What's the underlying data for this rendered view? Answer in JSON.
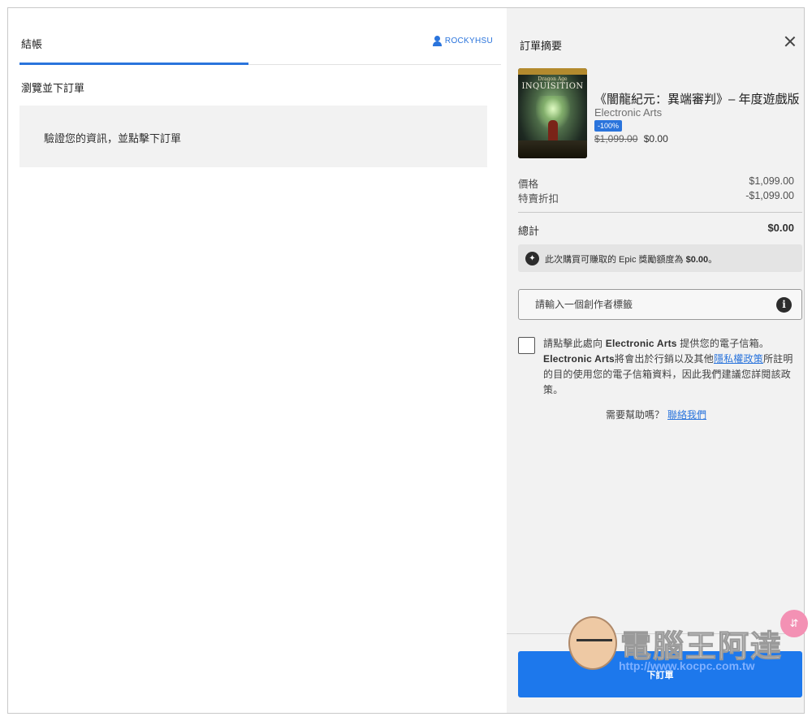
{
  "checkout": {
    "tab_label": "結帳",
    "username": "ROCKYHSU",
    "review_title": "瀏覽並下訂單",
    "verify_message": "驗證您的資訊，並點擊下訂單"
  },
  "summary": {
    "title": "訂單摘要",
    "game": {
      "cover_subtitle": "Dragon Age",
      "cover_title": "INQUISITION",
      "title": "《闇龍紀元：異端審判》– 年度遊戲版",
      "publisher": "Electronic Arts",
      "discount": "-100%",
      "original_price": "$1,099.00",
      "final_price": "$0.00"
    },
    "price_label": "價格",
    "price_value": "$1,099.00",
    "discount_label": "特賣折扣",
    "discount_value": "-$1,099.00",
    "total_label": "總計",
    "total_value": "$0.00",
    "reward_text": "此次購買可賺取的 Epic 獎勵額度為",
    "reward_value": "$0.00",
    "reward_suffix": "。",
    "creator_placeholder": "請輸入一個創作者標籤",
    "consent": {
      "part1": "請點擊此處向",
      "publisher1": "Electronic Arts",
      "part2": "提供您的電子信箱。",
      "publisher2": "Electronic Arts",
      "part3": "將會出於行銷以及其他",
      "privacy_link": "隱私權政策",
      "part4": "所註明的目的使用您的電子信箱資料，因此我們建議您詳閱該政策。"
    },
    "help_text": "需要幫助嗎？",
    "contact_link": "聯絡我們",
    "place_order_label": "下訂單"
  },
  "watermark": {
    "name": "電腦王阿達",
    "url": "http://www.kocpc.com.tw"
  }
}
